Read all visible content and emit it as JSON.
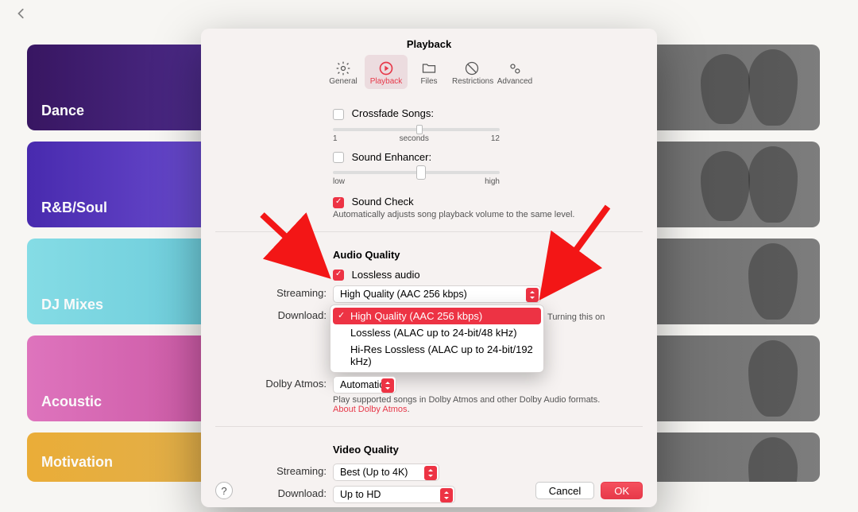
{
  "back_icon": "chevron-left",
  "tiles": [
    {
      "label": "Dance"
    },
    {
      "label": "R&B/Soul"
    },
    {
      "label": "DJ Mixes"
    },
    {
      "label": "Acoustic"
    },
    {
      "label": "Motivation"
    }
  ],
  "sheet": {
    "title": "Playback",
    "toolbar": {
      "general": "General",
      "playback": "Playback",
      "files": "Files",
      "restrictions": "Restrictions",
      "advanced": "Advanced"
    },
    "crossfade": {
      "label": "Crossfade Songs:",
      "min": "1",
      "mid": "seconds",
      "max": "12"
    },
    "enhancer": {
      "label": "Sound Enhancer:",
      "low": "low",
      "high": "high"
    },
    "soundcheck": {
      "label": "Sound Check",
      "hint": "Automatically adjusts song playback volume to the same level."
    },
    "audio": {
      "heading": "Audio Quality",
      "lossless": "Lossless audio",
      "streaming_label": "Streaming:",
      "streaming_value": "High Quality (AAC 256 kbps)",
      "download_label": "Download:",
      "download_hint_part": "urning this on",
      "dropdown": {
        "opt1": "High Quality (AAC 256 kbps)",
        "opt2": "Lossless (ALAC up to 24-bit/48 kHz)",
        "opt3": "Hi-Res Lossless (ALAC up to 24-bit/192 kHz)"
      },
      "dolby_label": "Dolby Atmos:",
      "dolby_value": "Automatic",
      "dolby_hint": "Play supported songs in Dolby Atmos and other Dolby Audio formats.",
      "dolby_link": "About Dolby Atmos"
    },
    "video": {
      "heading": "Video Quality",
      "streaming_label": "Streaming:",
      "streaming_value": "Best (Up to 4K)",
      "download_label": "Download:",
      "download_value": "Up to HD"
    },
    "footer": {
      "help": "?",
      "cancel": "Cancel",
      "ok": "OK"
    }
  }
}
